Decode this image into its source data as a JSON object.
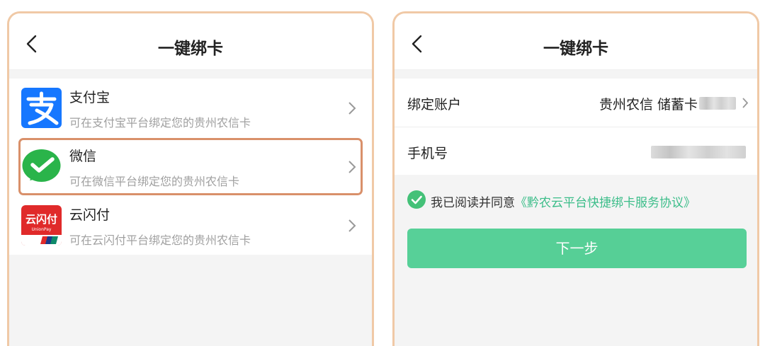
{
  "left": {
    "title": "一键绑卡",
    "items": [
      {
        "name": "支付宝",
        "desc": "可在支付宝平台绑定您的贵州农信卡",
        "icon": "alipay-logo",
        "color": "#1677ff"
      },
      {
        "name": "微信",
        "desc": "可在微信平台绑定您的贵州农信卡",
        "icon": "wechat-logo",
        "color": "#2ab44a"
      },
      {
        "name": "云闪付",
        "desc": "可在云闪付平台绑定您的贵州农信卡",
        "icon": "unionpay-logo",
        "color": "#e02a2a"
      }
    ],
    "unionpay_logo_text": "云闪付",
    "unionpay_logo_sub": "UnionPay"
  },
  "right": {
    "title": "一键绑卡",
    "account_label": "绑定账户",
    "account_value": "贵州农信 储蓄卡",
    "phone_label": "手机号",
    "agree_prefix": "我已阅读并同意",
    "agree_link": "《黔农云平台快捷绑卡服务协议》",
    "next_label": "下一步"
  },
  "colors": {
    "border": "#f0c9a6",
    "highlight": "#d9906a",
    "accent": "#49cc8f"
  }
}
